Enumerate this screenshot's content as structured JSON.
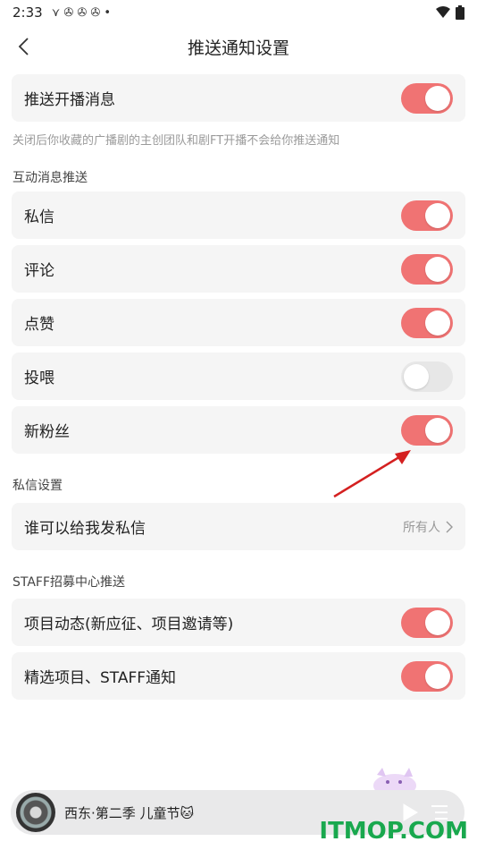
{
  "status_bar": {
    "time": "2:33",
    "notif_glyphs": "⋎ ✇ ✇ ✇ •",
    "icons": [
      "wifi-icon",
      "battery-icon"
    ]
  },
  "header": {
    "title": "推送通知设置",
    "back_icon": "chevron-left-icon"
  },
  "broadcast": {
    "label": "推送开播消息",
    "enabled": true,
    "hint": "关闭后你收藏的广播剧的主创团队和剧FT开播不会给你推送通知"
  },
  "interaction": {
    "section_title": "互动消息推送",
    "items": [
      {
        "label": "私信",
        "enabled": true
      },
      {
        "label": "评论",
        "enabled": true
      },
      {
        "label": "点赞",
        "enabled": true
      },
      {
        "label": "投喂",
        "enabled": false
      },
      {
        "label": "新粉丝",
        "enabled": true
      }
    ]
  },
  "private_message": {
    "section_title": "私信设置",
    "label": "谁可以给我发私信",
    "value": "所有人"
  },
  "staff": {
    "section_title": "STAFF招募中心推送",
    "items": [
      {
        "label": "项目动态(新应征、项目邀请等)",
        "enabled": true
      },
      {
        "label": "精选项目、STAFF通知",
        "enabled": true
      }
    ]
  },
  "player": {
    "track": "西东·第二季 儿童节🐱"
  },
  "watermark": "ITMOP.COM",
  "colors": {
    "toggle_on": "#f07373",
    "toggle_off": "#e7e7e7",
    "card_bg": "#f5f5f5",
    "annotation_arrow": "#d42020"
  }
}
